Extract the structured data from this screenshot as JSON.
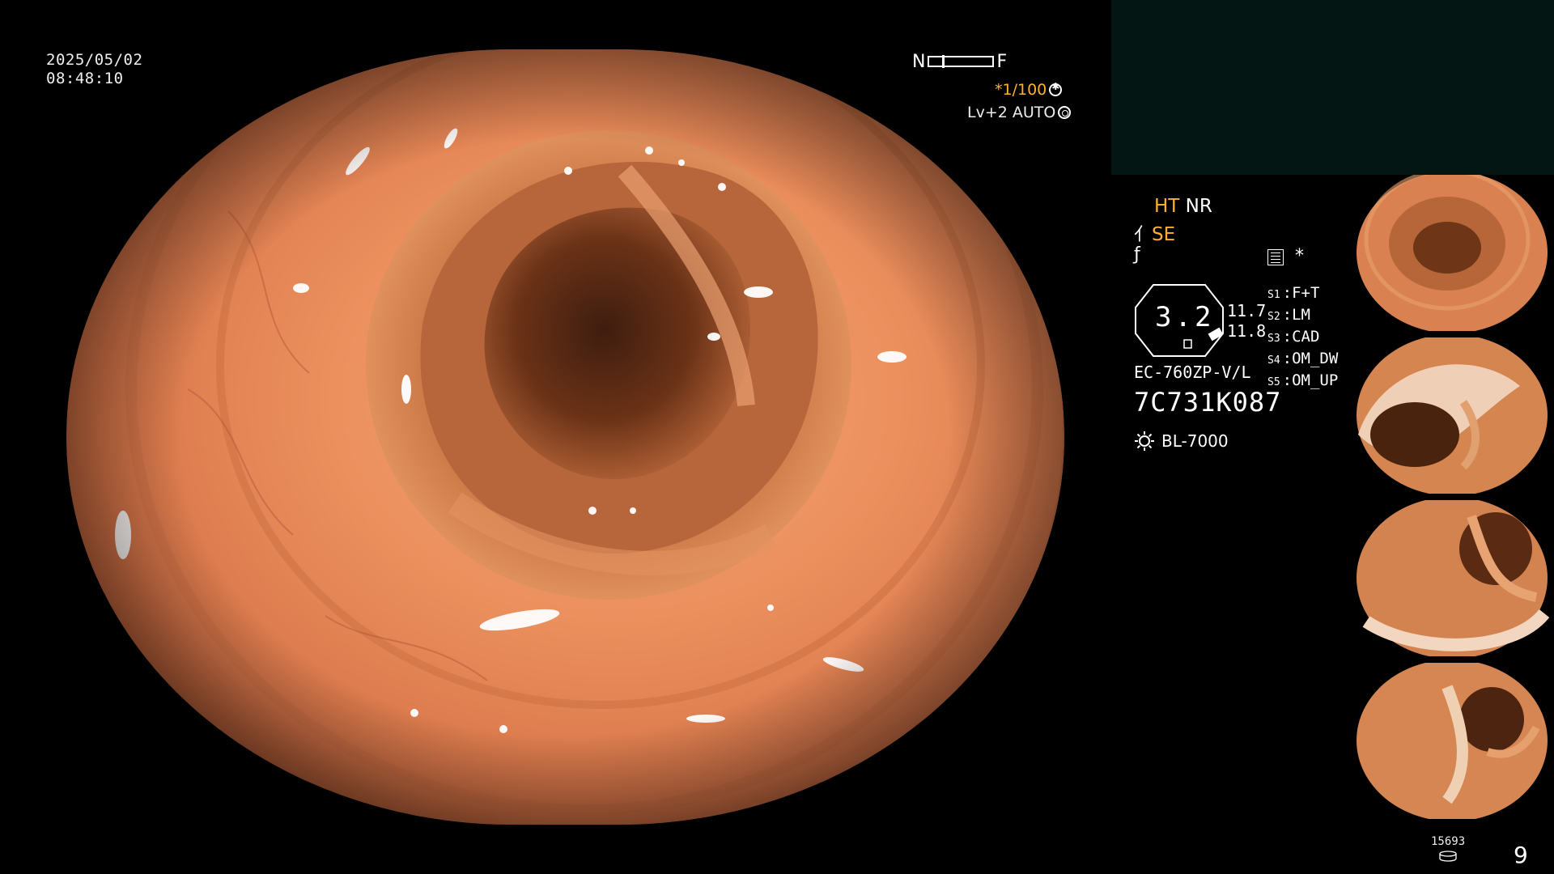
{
  "datetime": {
    "date": "2025/05/02",
    "time": "08:48:10"
  },
  "nf_indicator": {
    "near": "N",
    "far": "F"
  },
  "shutter": {
    "value": "*1/100"
  },
  "level": {
    "text": "Lv+2 AUTO"
  },
  "modes": {
    "ht": "HT",
    "nr": "NR",
    "se": "SE"
  },
  "zoom": {
    "value": "3.2",
    "small_top": "11.7",
    "small_bottom": "11.8"
  },
  "scope": {
    "model": "EC-760ZP-V/L",
    "serial": "7C731K087"
  },
  "light_source": {
    "name": "BL-7000"
  },
  "star_mark": "*",
  "switches": [
    {
      "key": "S1",
      "value": "F+T"
    },
    {
      "key": "S2",
      "value": "LM"
    },
    {
      "key": "S3",
      "value": "CAD"
    },
    {
      "key": "S4",
      "value": "OM_DW"
    },
    {
      "key": "S5",
      "value": "OM_UP"
    }
  ],
  "thumbnail_count": 4,
  "counter": {
    "top": "15693",
    "number": "9"
  },
  "colors": {
    "accent_orange": "#ffb12e",
    "panel_dark": "#041614",
    "background": "#000000"
  },
  "icons": [
    "shutter-icon",
    "auto-icon",
    "zoom-icon",
    "freeze-icon",
    "memo-icon",
    "light-icon",
    "disk-icon"
  ]
}
